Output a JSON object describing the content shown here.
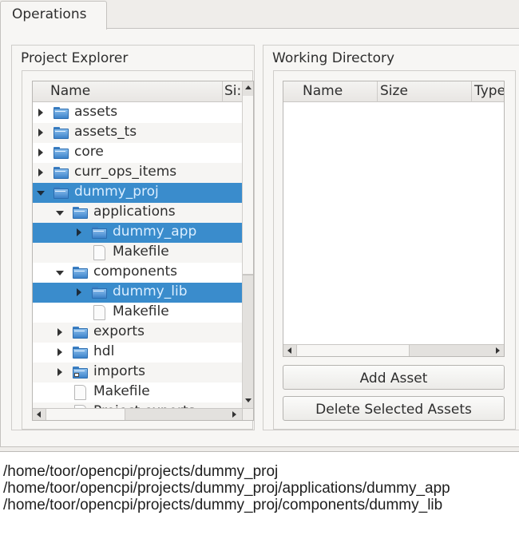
{
  "tabs": [
    {
      "label": "Operations",
      "active": true
    }
  ],
  "project_explorer": {
    "title": "Project Explorer",
    "columns": [
      "Name",
      "Si:"
    ],
    "rows": [
      {
        "label": "assets",
        "type": "folder",
        "depth": 0,
        "expander": "collapsed",
        "selected": false
      },
      {
        "label": "assets_ts",
        "type": "folder",
        "depth": 0,
        "expander": "collapsed",
        "selected": false
      },
      {
        "label": "core",
        "type": "folder",
        "depth": 0,
        "expander": "collapsed",
        "selected": false
      },
      {
        "label": "curr_ops_items",
        "type": "folder",
        "depth": 0,
        "expander": "collapsed",
        "selected": false
      },
      {
        "label": "dummy_proj",
        "type": "folder",
        "depth": 0,
        "expander": "expanded",
        "selected": true
      },
      {
        "label": "applications",
        "type": "folder",
        "depth": 1,
        "expander": "expanded",
        "selected": false
      },
      {
        "label": "dummy_app",
        "type": "folder",
        "depth": 2,
        "expander": "collapsed",
        "selected": true
      },
      {
        "label": "Makefile",
        "type": "file",
        "depth": 2,
        "expander": "none",
        "selected": false
      },
      {
        "label": "components",
        "type": "folder",
        "depth": 1,
        "expander": "expanded",
        "selected": false
      },
      {
        "label": "dummy_lib",
        "type": "folder",
        "depth": 2,
        "expander": "collapsed",
        "selected": true
      },
      {
        "label": "Makefile",
        "type": "file",
        "depth": 2,
        "expander": "none",
        "selected": false
      },
      {
        "label": "exports",
        "type": "folder",
        "depth": 1,
        "expander": "collapsed",
        "selected": false
      },
      {
        "label": "hdl",
        "type": "folder",
        "depth": 1,
        "expander": "collapsed",
        "selected": false
      },
      {
        "label": "imports",
        "type": "folder-link",
        "depth": 1,
        "expander": "collapsed",
        "selected": false
      },
      {
        "label": "Makefile",
        "type": "file",
        "depth": 1,
        "expander": "none",
        "selected": false
      },
      {
        "label": "Project.exports",
        "type": "file",
        "depth": 1,
        "expander": "none",
        "selected": false
      }
    ]
  },
  "working_directory": {
    "title": "Working Directory",
    "columns": [
      "Name",
      "Size",
      "Type"
    ],
    "rows": []
  },
  "buttons": {
    "add_asset": "Add Asset",
    "delete_selected": "Delete Selected Assets"
  },
  "output_lines": [
    "/home/toor/opencpi/projects/dummy_proj",
    "/home/toor/opencpi/projects/dummy_proj/applications/dummy_app",
    "/home/toor/opencpi/projects/dummy_proj/components/dummy_lib"
  ],
  "colors": {
    "selection": "#3a8ccc",
    "folder": "#3c82c9"
  }
}
